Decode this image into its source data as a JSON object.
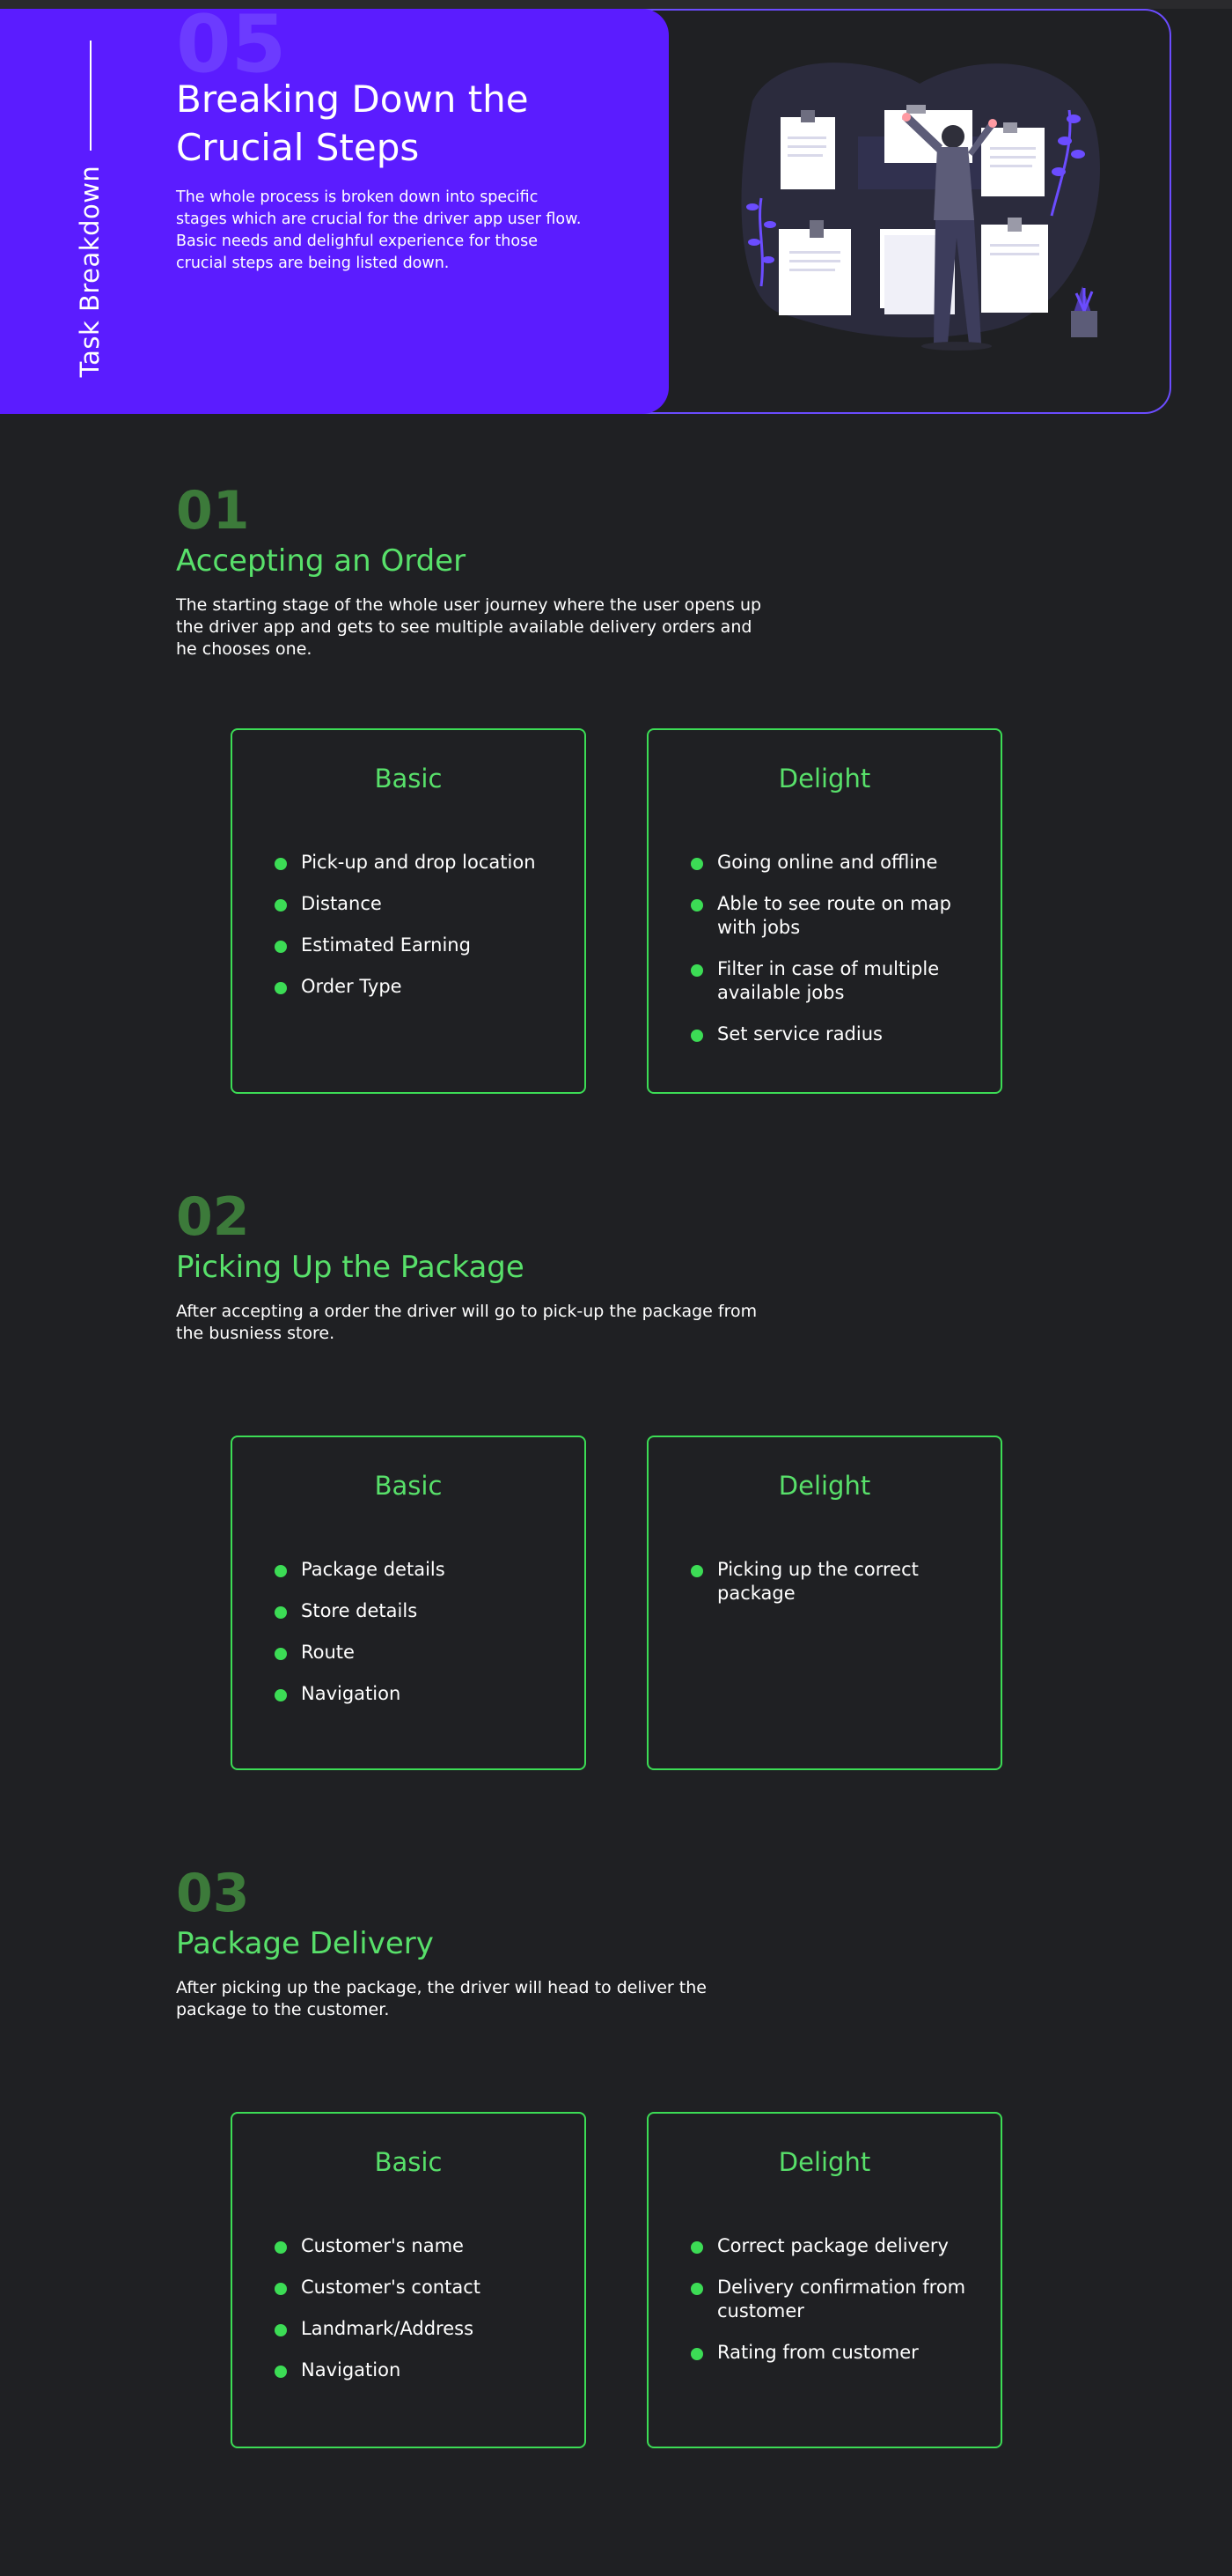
{
  "hero": {
    "side_label": "Task Breakdown",
    "number": "05",
    "title": "Breaking Down the Crucial Steps",
    "desc_line1": "The whole process is broken down into specific stages which are crucial for the driver app user flow.",
    "desc_line2": "Basic needs and delighful experience for those crucial steps are being listed down.",
    "illustration_icon": "person-planning-board-illustration"
  },
  "colors": {
    "accent_purple": "#5b1cff",
    "accent_green": "#58e06a",
    "number_green": "#3c7a3a",
    "background": "#1f2023"
  },
  "sections": [
    {
      "number": "01",
      "title": "Accepting an Order",
      "desc": "The starting stage of the whole user journey where the user opens up the driver app and gets to see multiple available delivery orders and he chooses one.",
      "basic": {
        "title": "Basic",
        "items": [
          "Pick-up and drop location",
          "Distance",
          "Estimated Earning",
          "Order Type"
        ]
      },
      "delight": {
        "title": "Delight",
        "items": [
          "Going online and offline",
          "Able to see route on map with jobs",
          "Filter in case of multiple available jobs",
          "Set service radius"
        ]
      }
    },
    {
      "number": "02",
      "title": "Picking Up the Package",
      "desc": "After accepting a order the driver will go to pick-up the package from the busniess store.",
      "basic": {
        "title": "Basic",
        "items": [
          "Package details",
          "Store details",
          "Route",
          "Navigation"
        ]
      },
      "delight": {
        "title": "Delight",
        "items": [
          "Picking up the correct package"
        ]
      }
    },
    {
      "number": "03",
      "title": "Package Delivery",
      "desc": "After picking up the package, the driver will head to deliver the package to the customer.",
      "basic": {
        "title": "Basic",
        "items": [
          "Customer's name",
          "Customer's contact",
          "Landmark/Address",
          "Navigation"
        ]
      },
      "delight": {
        "title": "Delight",
        "items": [
          "Correct package delivery",
          "Delivery confirmation from customer",
          "Rating from customer"
        ]
      }
    }
  ]
}
